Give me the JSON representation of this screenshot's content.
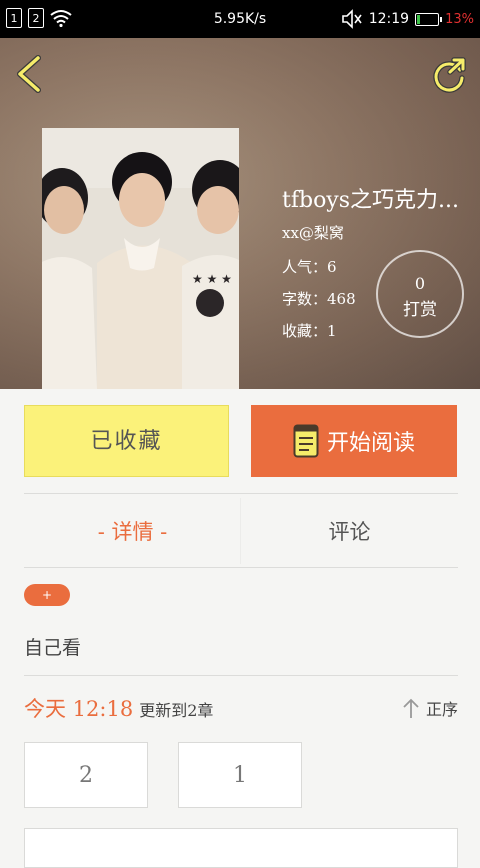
{
  "status_bar": {
    "sim1": "1",
    "sim2": "2",
    "speed": "5.95K/s",
    "time": "12:19",
    "battery_pct": "13%",
    "battery_level": 0.13
  },
  "book": {
    "title": "tfboys之巧克力...",
    "author": "xx@梨窝",
    "popularity_label": "人气：6",
    "word_count_label": "字数：468",
    "favorites_label": "收藏：1",
    "tip_count": "0",
    "tip_label": "打赏"
  },
  "actions": {
    "favorited_label": "已收藏",
    "read_label": "开始阅读"
  },
  "tabs": [
    {
      "label": "- 详情 -",
      "active": true
    },
    {
      "label": "评论",
      "active": false
    }
  ],
  "details": {
    "tag_label": "+",
    "description": "自己看",
    "update_today": "今天 12:18",
    "update_text": "更新到2章",
    "sort_label": "正序"
  },
  "chapters": [
    "2",
    "1"
  ],
  "colors": {
    "accent": "#ea6d3e",
    "favorite_button": "#fbf27a",
    "icon_yellow": "#f6ec6a"
  }
}
